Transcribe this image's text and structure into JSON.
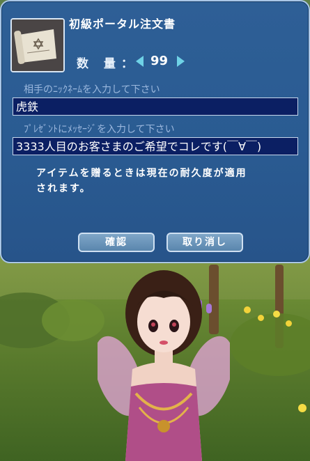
{
  "dialog": {
    "item_name": "初級ポータル注文書",
    "item_icon": "scroll-icon",
    "quantity_label": "数 量：",
    "quantity_value": "99",
    "nickname_label": "相手のﾆｯｸﾈｰﾑを入力して下さい",
    "nickname_value": "虎鉄",
    "message_label": "ﾌﾟﾚｾﾞﾝﾄにﾒｯｾｰｼﾞを入力して下さい",
    "message_value": "3333人目のお客さまのご希望でコレです(￣∀￣)",
    "notice_line1": "アイテムを贈るときは現在の耐久度が適用",
    "notice_line2": "されます。",
    "confirm_label": "確認",
    "cancel_label": "取り消し"
  },
  "colors": {
    "dialog_bg": "#2a5b92",
    "input_bg": "#0b1f63",
    "arrow": "#6fd2e6"
  }
}
